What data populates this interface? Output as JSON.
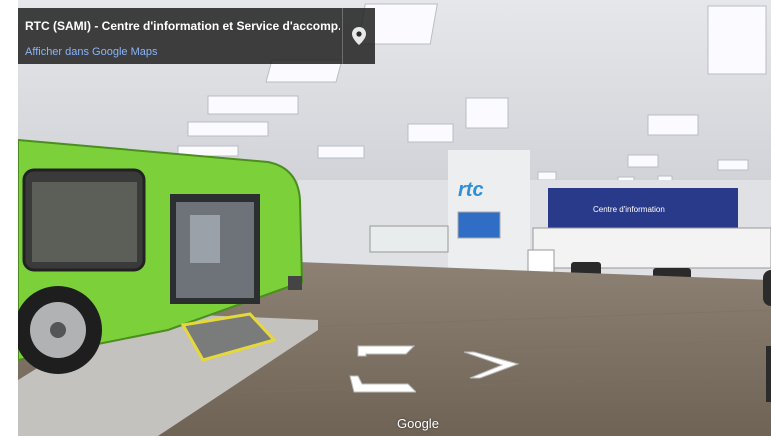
{
  "place": {
    "title": "RTC (SAMI) - Centre d'information et Service d'accomp...",
    "maps_link": "Afficher dans Google Maps",
    "pin_icon": "location-pin-icon"
  },
  "scene": {
    "sign_info": "Centre d'information",
    "logo": "rtc"
  },
  "navigation": {
    "back_icon": "chevron-back-icon",
    "forward_icon": "chevron-forward-icon"
  },
  "watermark": "Google",
  "colors": {
    "card_bg": "#222222",
    "link": "#8ab4f8",
    "bus_green": "#7cd13a",
    "floor": "#8a7a6a"
  }
}
